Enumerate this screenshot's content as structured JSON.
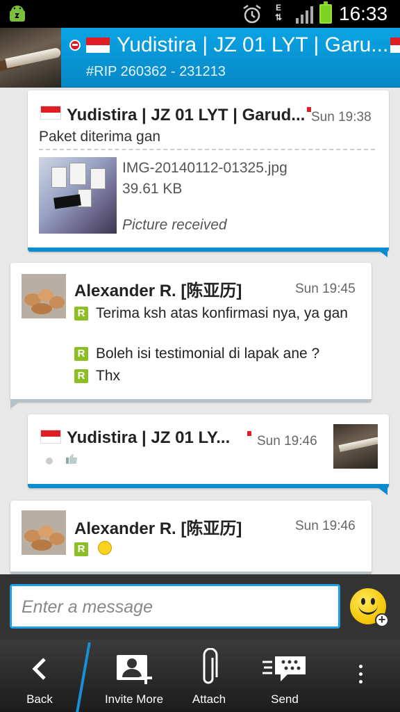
{
  "status_bar": {
    "network": "E",
    "time": "16:33"
  },
  "header": {
    "title": "Yudistira | JZ 01 LYT | Garu...",
    "subtitle": "#RIP 260362 - 231213"
  },
  "messages": [
    {
      "sender": "Yudistira | JZ 01 LYT | Garud...",
      "time": "Sun 19:38",
      "text": "Paket diterima gan",
      "attachment": {
        "filename": "IMG-20140112-01325.jpg",
        "size": "39.61 KB",
        "status": "Picture received"
      }
    },
    {
      "sender": "Alexander R. [陈亚历]",
      "time": "Sun 19:45",
      "lines": [
        "Terima ksh atas konfirmasi nya, ya gan",
        "Boleh isi testimonial di lapak ane ?",
        "Thx"
      ],
      "read_icon": "R"
    },
    {
      "sender": "Yudistira | JZ 01 LY...",
      "time": "Sun 19:46"
    },
    {
      "sender": "Alexander R. [陈亚历]",
      "time": "Sun 19:46",
      "read_icon": "R"
    }
  ],
  "composer": {
    "placeholder": "Enter a message"
  },
  "toolbar": {
    "back_label": "Back",
    "invite_label": "Invite More",
    "attach_label": "Attach",
    "send_label": "Send"
  },
  "colors": {
    "accent": "#0a8cd0",
    "header_blue": "#0aa4e4",
    "read_green": "#8cbf26"
  }
}
